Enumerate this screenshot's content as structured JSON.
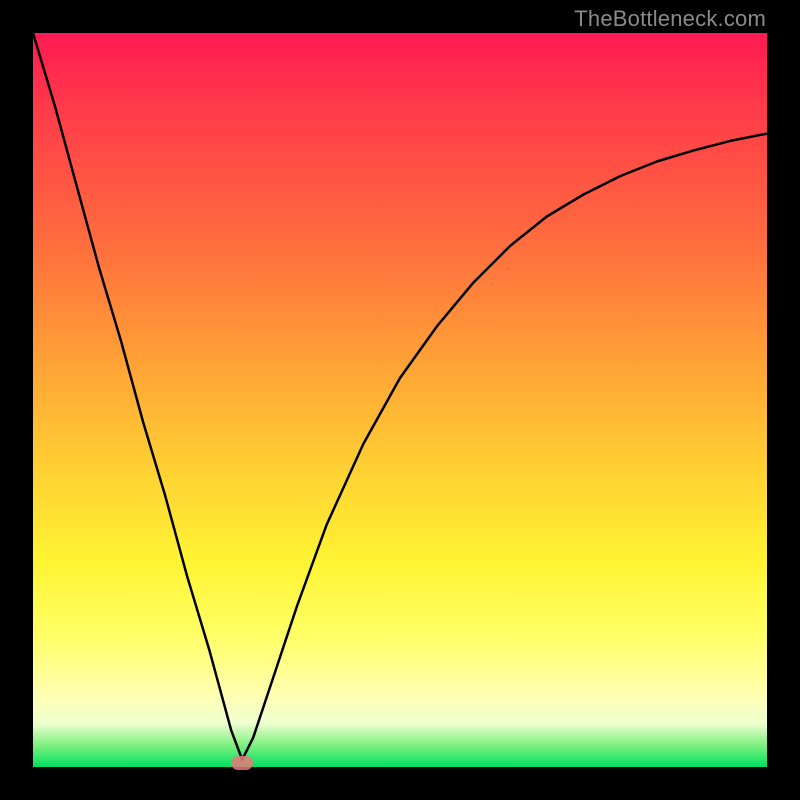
{
  "watermark": "TheBottleneck.com",
  "chart_data": {
    "type": "line",
    "title": "",
    "xlabel": "",
    "ylabel": "",
    "xlim": [
      0,
      100
    ],
    "ylim": [
      0,
      100
    ],
    "grid": false,
    "legend": false,
    "gradient": {
      "direction": "vertical",
      "stops": [
        {
          "pos": 0.0,
          "color": "#ff1a52"
        },
        {
          "pos": 0.1,
          "color": "#ff3a4a"
        },
        {
          "pos": 0.28,
          "color": "#ff6b3e"
        },
        {
          "pos": 0.45,
          "color": "#ffa236"
        },
        {
          "pos": 0.6,
          "color": "#ffd233"
        },
        {
          "pos": 0.72,
          "color": "#fff433"
        },
        {
          "pos": 0.82,
          "color": "#ffff66"
        },
        {
          "pos": 0.9,
          "color": "#ffffb0"
        },
        {
          "pos": 0.94,
          "color": "#f0ffd0"
        },
        {
          "pos": 0.97,
          "color": "#80f080"
        },
        {
          "pos": 1.0,
          "color": "#00e060"
        }
      ]
    },
    "series": [
      {
        "name": "bottleneck-curve",
        "color": "#000000",
        "stroke_width": 2.5,
        "x": [
          0,
          3,
          6,
          9,
          12,
          15,
          18,
          21,
          24,
          27,
          28.5,
          30,
          33,
          36,
          40,
          45,
          50,
          55,
          60,
          65,
          70,
          75,
          80,
          85,
          90,
          95,
          100
        ],
        "y": [
          100,
          90,
          79,
          68,
          58,
          47,
          37,
          26,
          16,
          5,
          1,
          4,
          13,
          22,
          33,
          44,
          53,
          60,
          66,
          71,
          75,
          78,
          80.5,
          82.5,
          84,
          85.3,
          86.3
        ]
      }
    ],
    "markers": [
      {
        "name": "optimum-marker",
        "x": 28.5,
        "y": 0.5,
        "color": "#e67a7a",
        "shape": "pill"
      }
    ]
  }
}
